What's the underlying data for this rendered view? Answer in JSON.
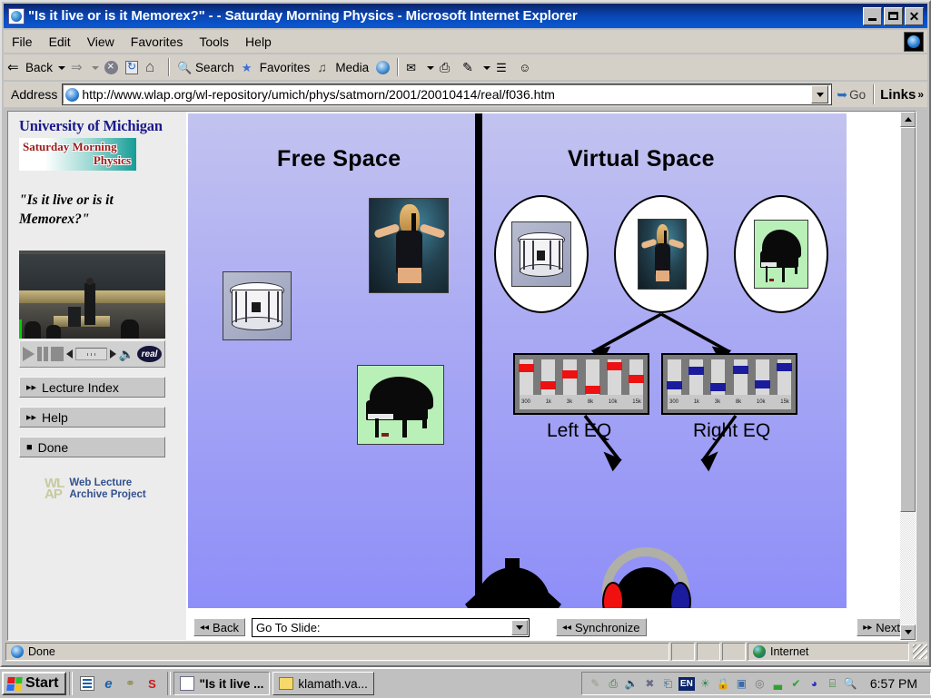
{
  "window": {
    "title": "\"Is it live or is it Memorex?\" - - Saturday Morning Physics - Microsoft Internet Explorer",
    "icon": "ie-document-icon",
    "minimize_label": "_",
    "maximize_label": "□",
    "close_label": "×"
  },
  "menu": {
    "items": [
      {
        "label": "File"
      },
      {
        "label": "Edit"
      },
      {
        "label": "View"
      },
      {
        "label": "Favorites"
      },
      {
        "label": "Tools"
      },
      {
        "label": "Help"
      }
    ]
  },
  "toolbar": {
    "back_label": "Back",
    "forward_label": "",
    "stop_label": "",
    "refresh_label": "",
    "home_label": "",
    "search_label": "Search",
    "favorites_label": "Favorites",
    "media_label": "Media",
    "history_label": "",
    "mail_label": "",
    "print_label": "",
    "edit_label": "",
    "discuss_label": "",
    "messenger_label": ""
  },
  "address": {
    "label": "Address",
    "url": "http://www.wlap.org/wl-repository/umich/phys/satmorn/2001/20010414/real/f036.htm",
    "go_label": "Go",
    "links_label": "Links",
    "links_chevron": "»"
  },
  "sidebar": {
    "university": "University of Michigan",
    "program_logo_line1": "Saturday Morning",
    "program_logo_line2": "Physics",
    "lecture_title": "\"Is it live or is it Memorex?\"",
    "player": {
      "play": "▶",
      "pause": "‖",
      "stop": "■",
      "prev": "◀",
      "next": "▶",
      "volume": "🔊",
      "brand": "real"
    },
    "buttons": [
      {
        "glyph": "▸▸",
        "label": "Lecture Index"
      },
      {
        "glyph": "▸▸",
        "label": "Help"
      },
      {
        "glyph": "■",
        "label": "Done"
      }
    ],
    "wlap": {
      "mark": "WL\nAP",
      "line1": "Web Lecture",
      "line2": "Archive Project"
    }
  },
  "slide": {
    "heading_left": "Free Space",
    "heading_right": "Virtual Space",
    "free_space_items": [
      {
        "name": "snare-drum",
        "type": "image"
      },
      {
        "name": "singer",
        "type": "image"
      },
      {
        "name": "grand-piano",
        "type": "image"
      },
      {
        "name": "listener-head",
        "type": "shape"
      }
    ],
    "virtual_space_circles": [
      {
        "name": "snare-drum-circle"
      },
      {
        "name": "singer-circle"
      },
      {
        "name": "grand-piano-circle"
      }
    ],
    "eq_left": {
      "label": "Left EQ",
      "color": "#ee1111",
      "bands": [
        "300",
        "1k",
        "3k",
        "8k",
        "10k",
        "15k"
      ],
      "levels": [
        78,
        30,
        60,
        18,
        82,
        48
      ]
    },
    "eq_right": {
      "label": "Right EQ",
      "color": "#1b1b9e",
      "bands": [
        "300",
        "1k",
        "3k",
        "8k",
        "10k",
        "15k"
      ],
      "levels": [
        30,
        72,
        26,
        74,
        32,
        80
      ]
    },
    "listener": {
      "name": "person-with-headphones",
      "left_cup_color": "#f01010",
      "right_cup_color": "#1b1b9e",
      "band_color": "#b0b0a6"
    },
    "colors": {
      "background_top": "#c3c3f0",
      "background_bottom": "#8e8ef8",
      "divider": "#000000"
    }
  },
  "slide_nav": {
    "back_label": "Back",
    "back_glyph": "◂◂",
    "goto_label": "Go To Slide:",
    "sync_label": "Synchronize",
    "sync_glyph": "◂◂",
    "next_label": "Next",
    "next_glyph": "▸▸"
  },
  "status": {
    "text": "Done",
    "zone": "Internet"
  },
  "taskbar": {
    "start_label": "Start",
    "quicklaunch": [
      {
        "name": "show-desktop-icon",
        "glyph": "✎"
      },
      {
        "name": "internet-explorer-icon",
        "glyph": "e"
      },
      {
        "name": "network-icon",
        "glyph": "⛭"
      },
      {
        "name": "skype-icon",
        "glyph": "S"
      }
    ],
    "tasks": [
      {
        "name": "ie-window-task",
        "label": "\"Is it live ...",
        "active": true
      },
      {
        "name": "explorer-window-task",
        "label": "klamath.va...",
        "active": false
      }
    ],
    "tray_icons": [
      {
        "name": "mouse-icon",
        "glyph": "✐"
      },
      {
        "name": "printer-icon",
        "glyph": "⎙"
      },
      {
        "name": "volume-icon",
        "glyph": "🔊"
      },
      {
        "name": "network-disconnected-icon",
        "glyph": "✖"
      },
      {
        "name": "network-connection-icon",
        "glyph": "⌗"
      },
      {
        "name": "language-indicator",
        "glyph": "EN"
      },
      {
        "name": "satellite-icon",
        "glyph": "☀"
      },
      {
        "name": "security-warning-icon",
        "glyph": "🔒"
      },
      {
        "name": "camera-icon",
        "glyph": "▣"
      },
      {
        "name": "cd-burner-icon",
        "glyph": "◎"
      },
      {
        "name": "signal-strength-icon",
        "glyph": "▃"
      },
      {
        "name": "antivirus-icon",
        "glyph": "✔"
      },
      {
        "name": "messenger-icon",
        "glyph": "◕"
      },
      {
        "name": "monitor-icon",
        "glyph": "⌸"
      },
      {
        "name": "search-icon",
        "glyph": "🔍"
      }
    ],
    "clock": "6:57 PM"
  }
}
